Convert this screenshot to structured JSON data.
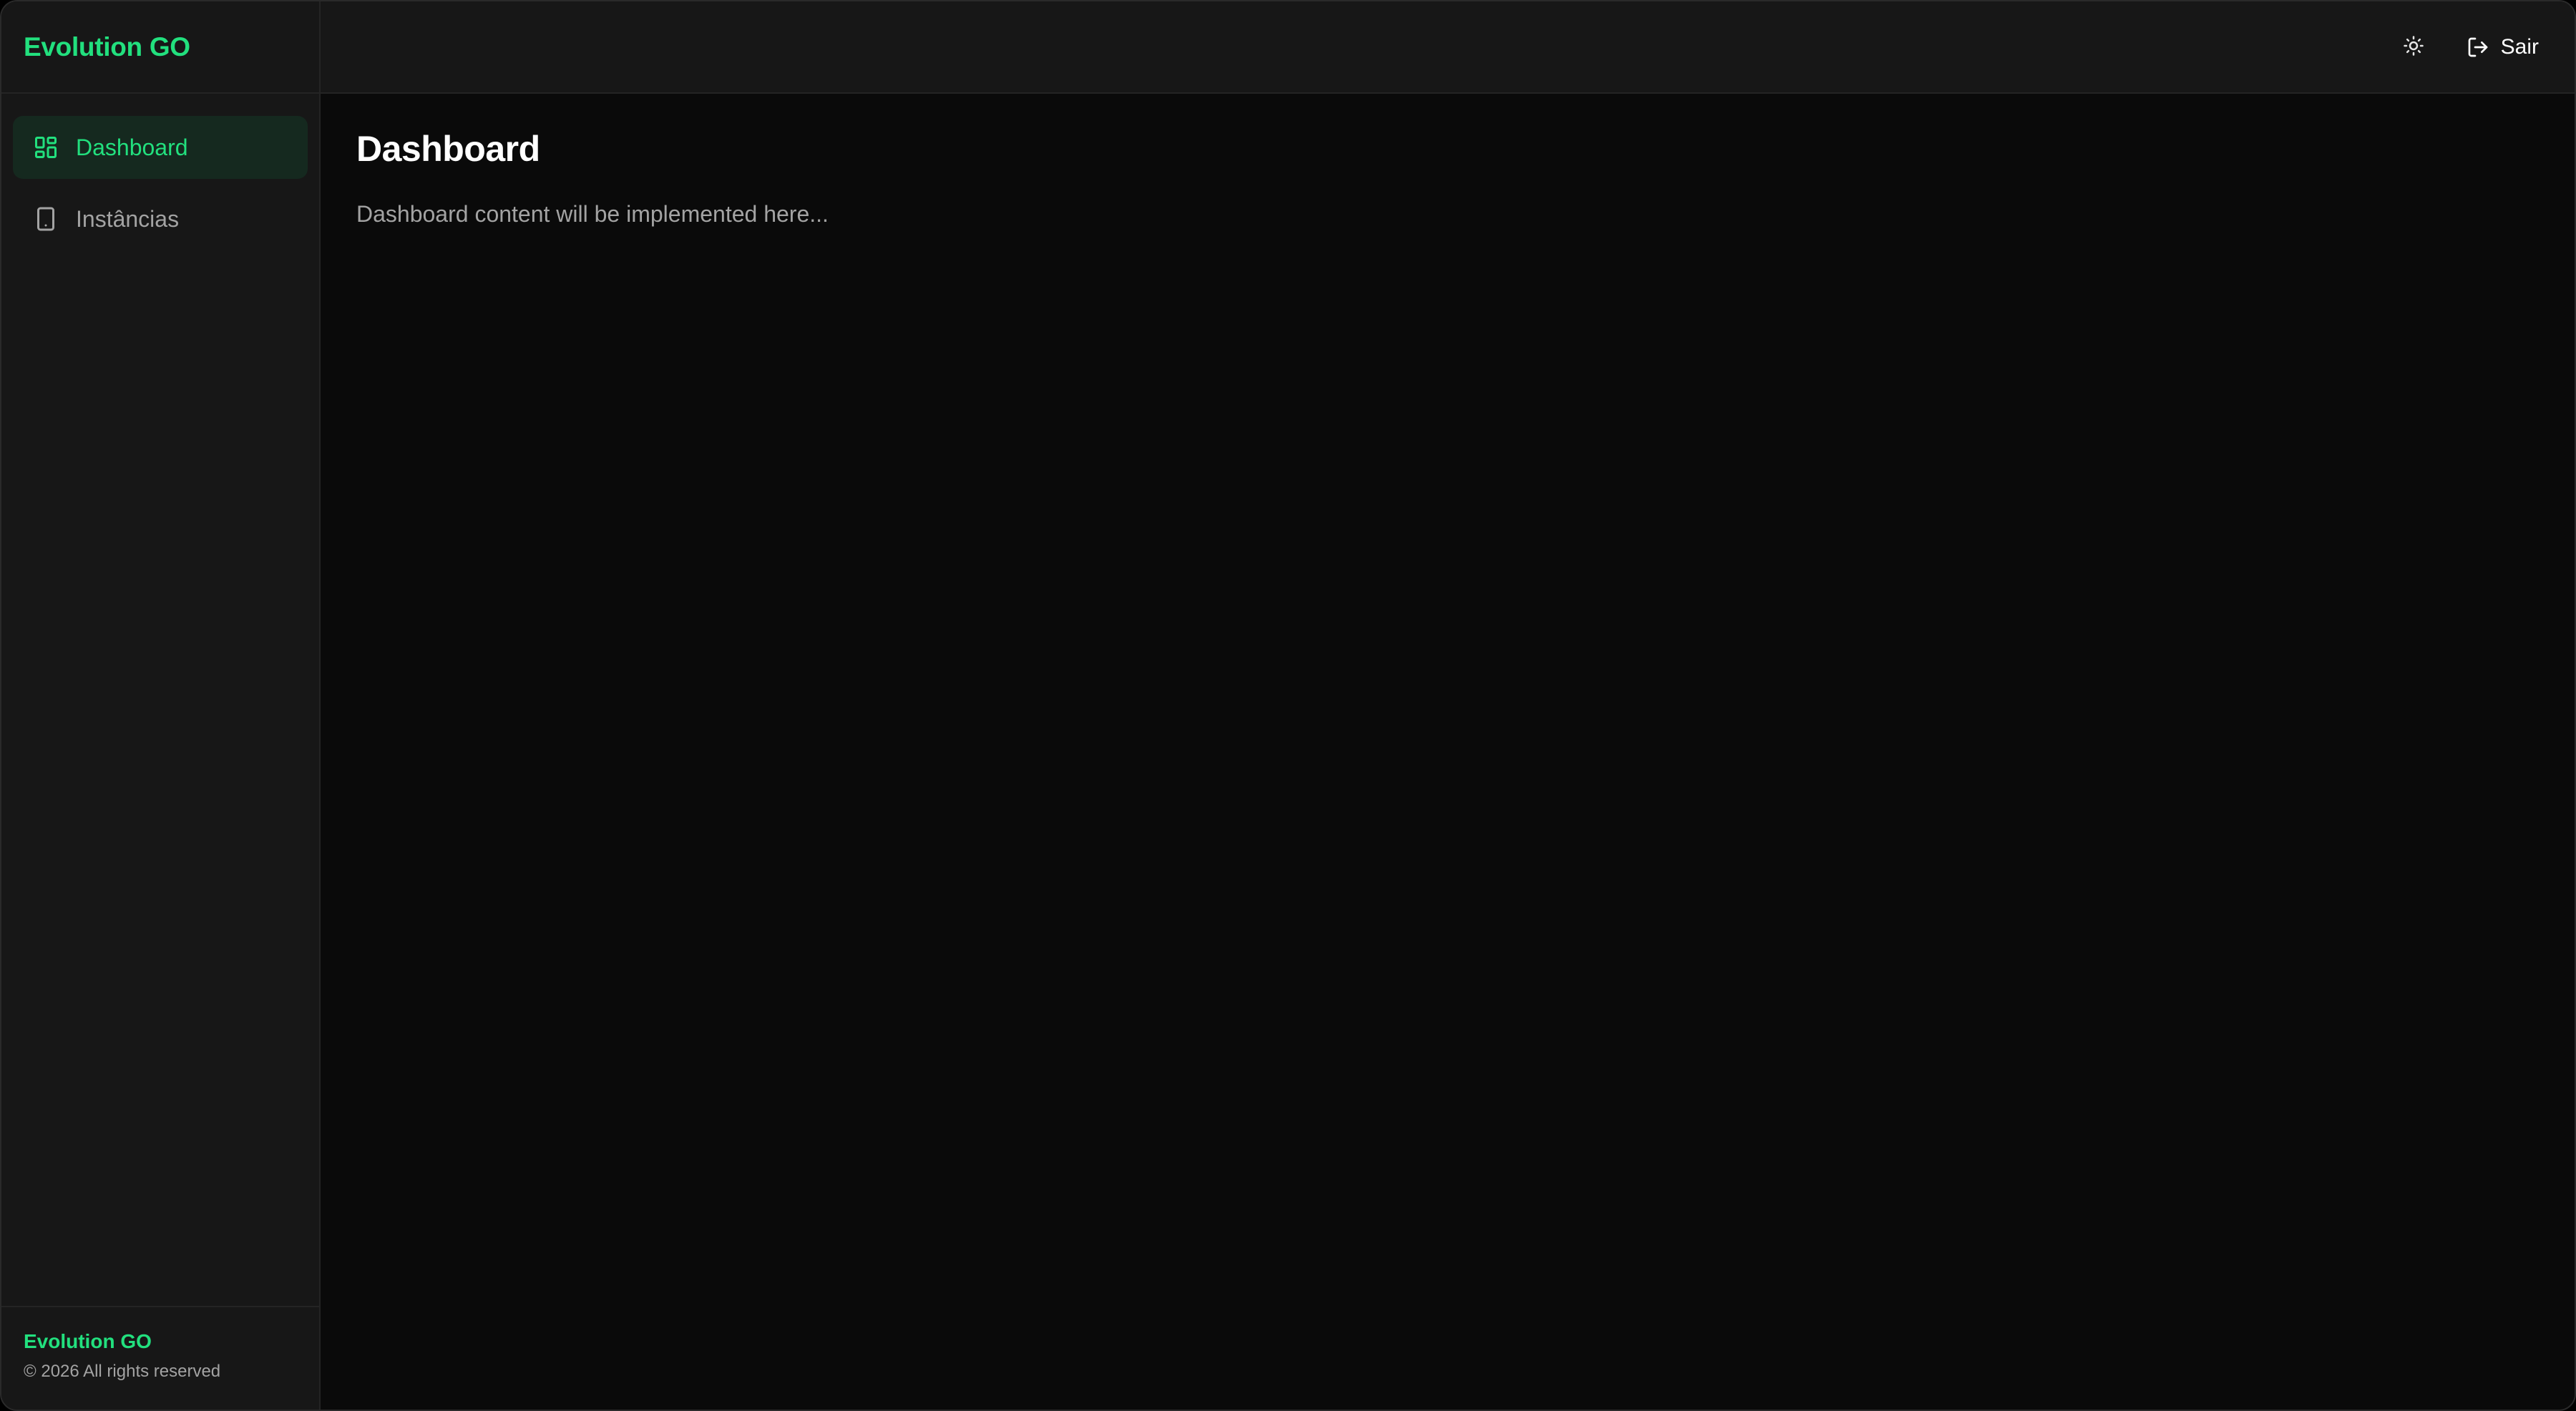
{
  "app": {
    "brand": "Evolution GO",
    "accent_color": "#22e07e"
  },
  "sidebar": {
    "items": [
      {
        "label": "Dashboard",
        "icon": "layout-dashboard-icon",
        "active": true
      },
      {
        "label": "Instâncias",
        "icon": "smartphone-icon",
        "active": false
      }
    ],
    "footer": {
      "brand": "Evolution GO",
      "copyright": "© 2026 All rights reserved"
    }
  },
  "header": {
    "theme_toggle_icon": "sun-icon",
    "logout_label": "Sair",
    "logout_icon": "log-out-icon"
  },
  "main": {
    "title": "Dashboard",
    "description": "Dashboard content will be implemented here..."
  }
}
